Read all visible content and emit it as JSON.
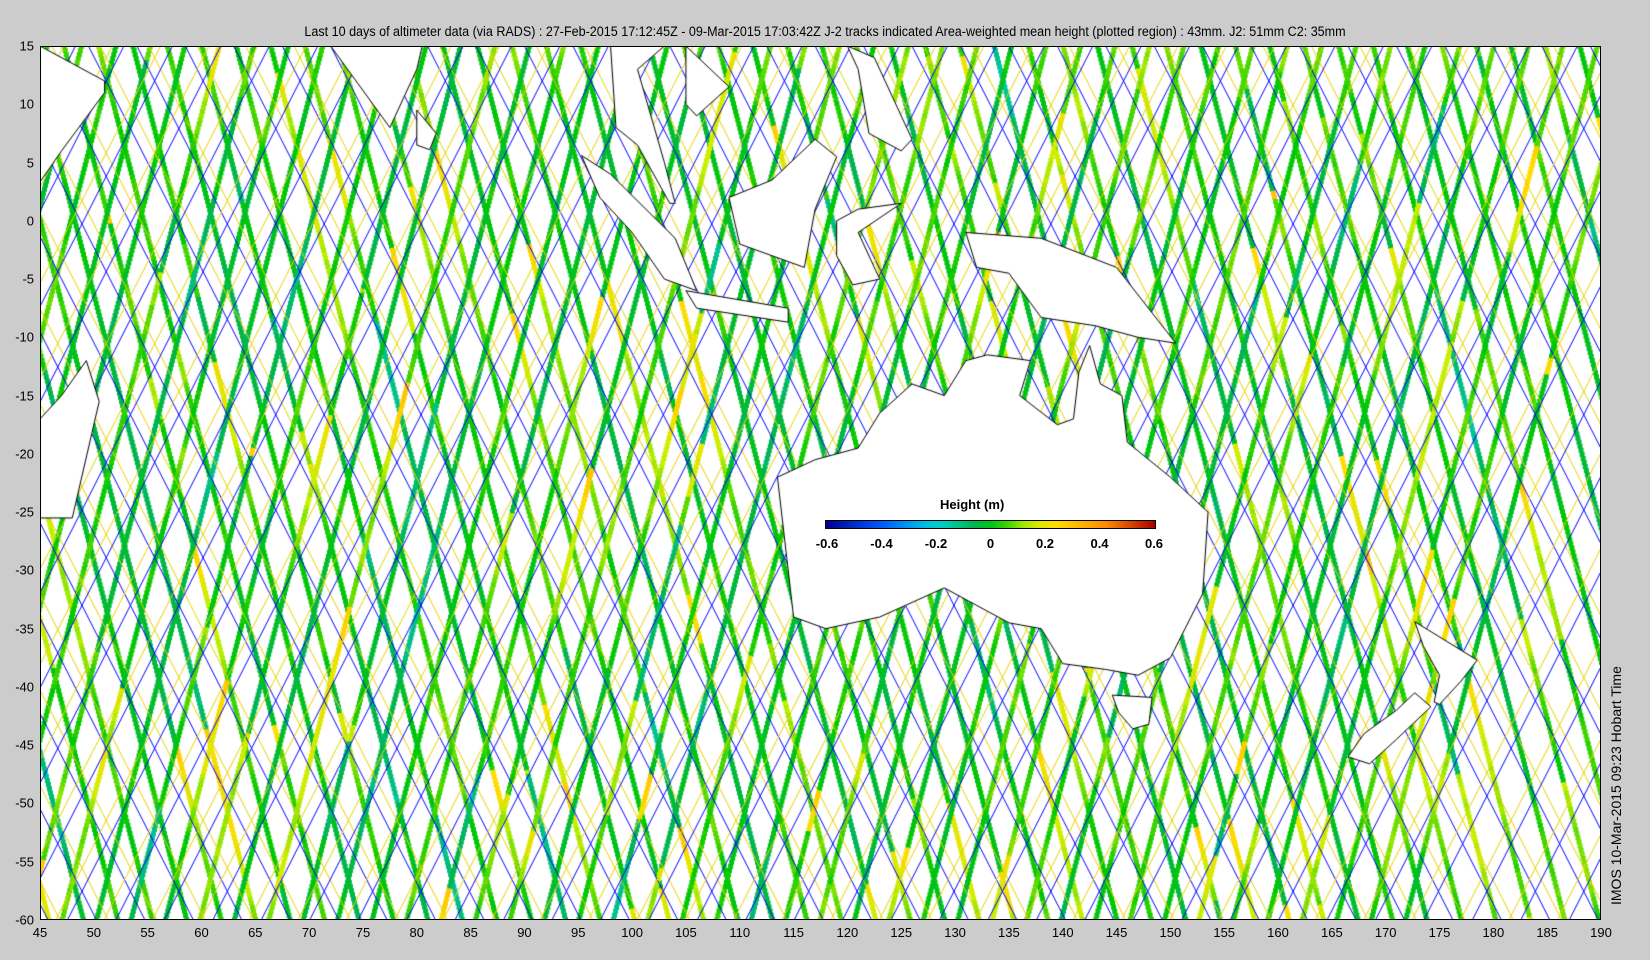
{
  "title": "Last 10 days of altimeter data (via RADS) : 27-Feb-2015 17:12:45Z - 09-Mar-2015 17:03:42Z  J-2 tracks indicated  Area-weighted mean height (plotted region) : 43mm.  J2: 51mm  C2: 35mm",
  "axes": {
    "lon_range": [
      45,
      190
    ],
    "lat_range": [
      -60,
      15
    ],
    "y_ticks": [
      "15",
      "10",
      "5",
      "0",
      "-5",
      "-10",
      "-15",
      "-20",
      "-25",
      "-30",
      "-35",
      "-40",
      "-45",
      "-50",
      "-55",
      "-60"
    ],
    "x_ticks": [
      "45",
      "50",
      "55",
      "60",
      "65",
      "70",
      "75",
      "80",
      "85",
      "90",
      "95",
      "100",
      "105",
      "110",
      "115",
      "120",
      "125",
      "130",
      "135",
      "140",
      "145",
      "150",
      "155",
      "160",
      "165",
      "170",
      "175",
      "180",
      "185",
      "190"
    ]
  },
  "colorbar": {
    "title": "Height (m)",
    "range": [
      -0.6,
      0.6
    ],
    "ticks": [
      "-0.6",
      "-0.4",
      "-0.2",
      "0",
      "0.2",
      "0.4",
      "0.6"
    ]
  },
  "side_label": "IMOS 10-Mar-2015 09:23 Hobart Time",
  "colors": {
    "background": "#cccccc",
    "j2_track_blue": "#0000ff",
    "j2_track_yellow": "#e6d200"
  }
}
